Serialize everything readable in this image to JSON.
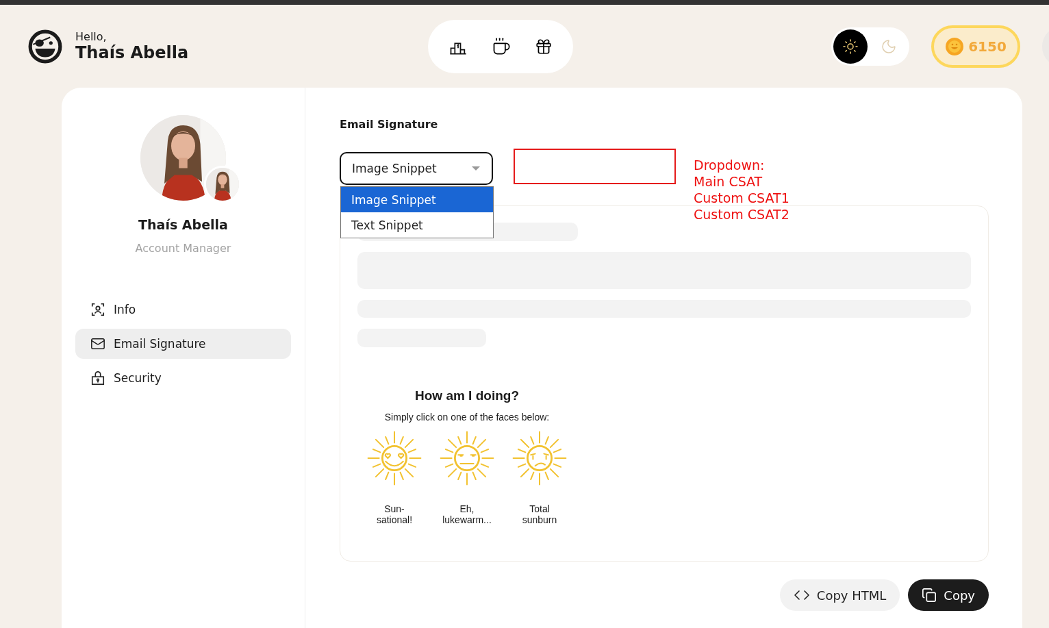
{
  "header": {
    "greeting": "Hello,",
    "user_name": "Thaís Abella",
    "theme_toggle": [
      {
        "kind": "light",
        "selected": true
      },
      {
        "kind": "dark",
        "selected": false
      }
    ],
    "coins": "6150"
  },
  "profile": {
    "name": "Thaís Abella",
    "role": "Account Manager"
  },
  "sidebar": {
    "items": [
      {
        "kind": "info",
        "label": "Info",
        "selected": false
      },
      {
        "kind": "email",
        "label": "Email Signature",
        "selected": true
      },
      {
        "kind": "security",
        "label": "Security",
        "selected": false
      }
    ]
  },
  "content": {
    "title": "Email Signature",
    "select": {
      "value": "Image Snippet",
      "expanded": true,
      "options": [
        {
          "label": "Image Snippet",
          "selected": true
        },
        {
          "label": "Text Snippet",
          "selected": false
        }
      ]
    },
    "annotation": [
      "Dropdown:",
      "Main CSAT",
      "Custom CSAT1",
      "Custom CSAT2"
    ],
    "csat": {
      "title": "How am I doing?",
      "subtitle": "Simply click on one of the faces below:",
      "options": [
        {
          "kind": "love",
          "label": "Sun-sational!"
        },
        {
          "kind": "neutral",
          "label": "Eh, lukewarm..."
        },
        {
          "kind": "upset",
          "label": "Total sunburn"
        }
      ]
    },
    "buttons": [
      {
        "kind": "code",
        "label": "Copy HTML"
      },
      {
        "kind": "copy",
        "label": "Copy"
      }
    ]
  }
}
